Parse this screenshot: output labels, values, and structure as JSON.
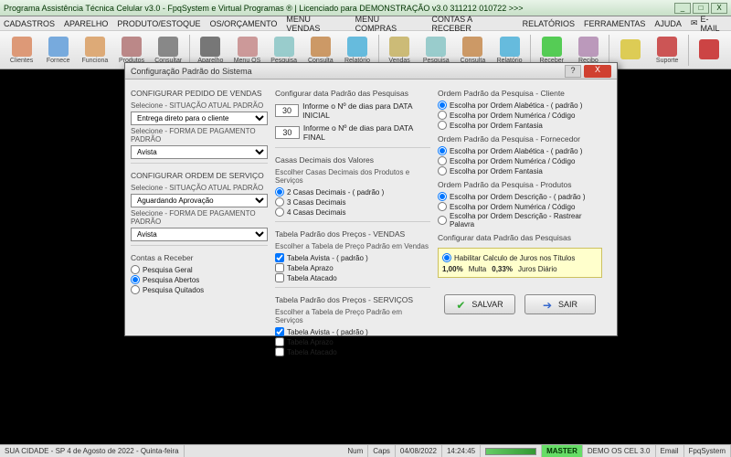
{
  "window": {
    "title": "Programa Assistência Técnica Celular v3.0 - FpqSystem e Virtual Programas ® | Licenciado para  DEMONSTRAÇÃO v3.0 311212 010722 >>>",
    "min": "_",
    "max": "□",
    "close": "X"
  },
  "menu": {
    "items": [
      "CADASTROS",
      "APARELHO",
      "PRODUTO/ESTOQUE",
      "OS/ORÇAMENTO",
      "MENU VENDAS",
      "MENU COMPRAS",
      "CONTAS A RECEBER",
      "RELATÓRIOS",
      "FERRAMENTAS",
      "AJUDA"
    ],
    "email": "E-MAIL"
  },
  "toolbar": [
    {
      "label": "Clientes",
      "color": "#d97"
    },
    {
      "label": "Fornece",
      "color": "#7ad"
    },
    {
      "label": "Funciona",
      "color": "#da7"
    },
    {
      "label": "Produtos",
      "color": "#b88"
    },
    {
      "label": "Consultar",
      "color": "#888"
    },
    {
      "sep": true
    },
    {
      "label": "Aparelho",
      "color": "#777"
    },
    {
      "label": "Menu OS",
      "color": "#c99"
    },
    {
      "label": "Pesquisa",
      "color": "#9cc"
    },
    {
      "label": "Consulta",
      "color": "#c96"
    },
    {
      "label": "Relatório",
      "color": "#6bd"
    },
    {
      "sep": true
    },
    {
      "label": "Vendas",
      "color": "#cb7"
    },
    {
      "label": "Pesquisa",
      "color": "#9cc"
    },
    {
      "label": "Consulta",
      "color": "#c96"
    },
    {
      "label": "Relatório",
      "color": "#6bd"
    },
    {
      "sep": true
    },
    {
      "label": "Receber",
      "color": "#5c5"
    },
    {
      "label": "Recibo",
      "color": "#b9b"
    },
    {
      "sep": true
    },
    {
      "label": "",
      "color": "#dc5"
    },
    {
      "label": "Suporte",
      "color": "#c55"
    },
    {
      "sep": true
    },
    {
      "label": "",
      "color": "#c44"
    }
  ],
  "dialog": {
    "title": "Configuração Padrão do Sistema",
    "col1": {
      "pedido_h": "CONFIGURAR PEDIDO DE VENDAS",
      "situacao_lbl": "Selecione - SITUAÇÃO ATUAL PADRÃO",
      "situacao_val": "Entrega direto para o cliente",
      "forma_lbl": "Selecione - FORMA DE PAGAMENTO PADRÃO",
      "forma_val": "Avista",
      "ordem_h": "CONFIGURAR ORDEM DE SERVIÇO",
      "os_sit_lbl": "Selecione - SITUAÇÃO ATUAL PADRÃO",
      "os_sit_val": "Aguardando Aprovação",
      "os_forma_lbl": "Selecione - FORMA DE PAGAMENTO PADRÃO",
      "os_forma_val": "Avista",
      "contas_h": "Contas a Receber",
      "contas": [
        "Pesquisa Geral",
        "Pesquisa Abertos",
        "Pesquisa Quitados"
      ],
      "contas_sel": 1
    },
    "col2": {
      "pesq_h": "Configurar data Padrão das Pesquisas",
      "pesq_ini_val": "30",
      "pesq_ini_lbl": "Informe o Nº de dias para DATA INICIAL",
      "pesq_fim_val": "30",
      "pesq_fim_lbl": "Informe o Nº de dias para DATA FINAL",
      "casas_h": "Casas Decimais dos Valores",
      "casas_sub": "Escolher Casas Decimais dos Produtos e Serviços",
      "casas": [
        "2 Casas Decimais  - ( padrão )",
        "3 Casas Decimais",
        "4 Casas Decimais"
      ],
      "casas_sel": 0,
      "vendas_h": "Tabela Padrão dos Preços - VENDAS",
      "vendas_sub": "Escolher a Tabela de Preço Padrão em Vendas",
      "vendas_opts": [
        "Tabela Avista -  ( padrão )",
        "Tabela Aprazo",
        "Tabela Atacado"
      ],
      "servicos_h": "Tabela Padrão dos Preços - SERVIÇOS",
      "servicos_sub": "Escolher a Tabela de Preço Padrão em Serviços",
      "servicos_opts": [
        "Tabela Avista -  ( padrão )",
        "Tabela Aprazo",
        "Tabela Atacado"
      ]
    },
    "col3": {
      "cli_h": "Ordem Padrão da Pesquisa - Cliente",
      "cli": [
        "Escolha por Ordem Alabética - ( padrão )",
        "Escolha por Ordem Numérica / Código",
        "Escolha por Ordem Fantasia"
      ],
      "cli_sel": 0,
      "for_h": "Ordem Padrão da Pesquisa - Fornecedor",
      "for": [
        "Escolha por Ordem Alabética - ( padrão )",
        "Escolha por Ordem Numérica / Código",
        "Escolha por Ordem Fantasia"
      ],
      "for_sel": 0,
      "prod_h": "Ordem Padrão da Pesquisa - Produtos",
      "prod": [
        "Escolha por Ordem Descrição - ( padrão )",
        "Escolha por Ordem Numérica / Código",
        "Escolha por Ordem Descrição - Rastrear Palavra"
      ],
      "prod_sel": 0,
      "juros_h": "Configurar data Padrão das Pesquisas",
      "juros_chk": "Habilitar Calculo de Juros nos Títulos",
      "juros_v1": "1,00%",
      "juros_l1": "Multa",
      "juros_v2": "0,33%",
      "juros_l2": "Juros Diário",
      "salvar": "SALVAR",
      "sair": "SAIR"
    }
  },
  "status": {
    "city": "SUA CIDADE - SP  4 de Agosto de 2022 - Quinta-feira",
    "num": "Num",
    "caps": "Caps",
    "date": "04/08/2022",
    "time": "14:24:45",
    "master": "MASTER",
    "demo": "DEMO OS CEL 3.0",
    "email": "Email",
    "fpq": "FpqSystem"
  }
}
